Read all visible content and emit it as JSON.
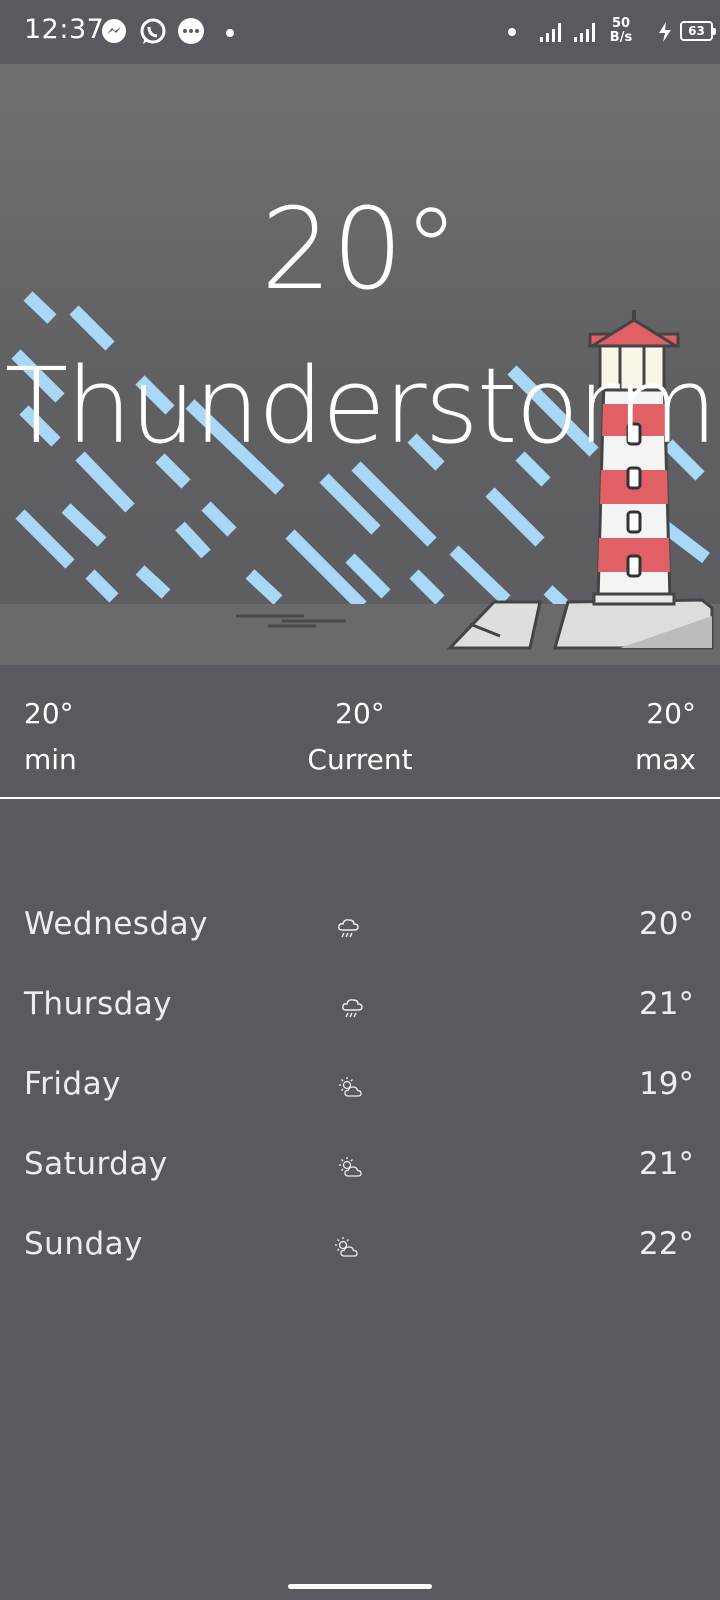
{
  "status_bar": {
    "time": "12:37",
    "net_speed_value": "50",
    "net_speed_unit": "B/s",
    "battery": "63",
    "icons": [
      "messenger-icon",
      "whatsapp-icon",
      "messages-icon",
      "dot-icon",
      "dot-icon",
      "signal-icon",
      "signal-icon",
      "charging-icon",
      "battery-icon"
    ]
  },
  "hero": {
    "temperature": "20°",
    "condition": "Thunderstorm",
    "colors": {
      "rain": "#a8d8f5",
      "lighthouse_red": "#e06065",
      "rock": "#d9d9d9"
    }
  },
  "summary": {
    "min": {
      "value": "20°",
      "label": "min"
    },
    "current": {
      "value": "20°",
      "label": "Current"
    },
    "max": {
      "value": "20°",
      "label": "max"
    }
  },
  "forecast": [
    {
      "day": "Wednesday",
      "icon": "rain-cloud-icon",
      "temp": "20°"
    },
    {
      "day": "Thursday",
      "icon": "rain-cloud-icon",
      "temp": "21°"
    },
    {
      "day": "Friday",
      "icon": "partly-cloudy-icon",
      "temp": "19°"
    },
    {
      "day": "Saturday",
      "icon": "partly-cloudy-icon",
      "temp": "21°"
    },
    {
      "day": "Sunday",
      "icon": "partly-cloudy-icon",
      "temp": "22°"
    }
  ]
}
